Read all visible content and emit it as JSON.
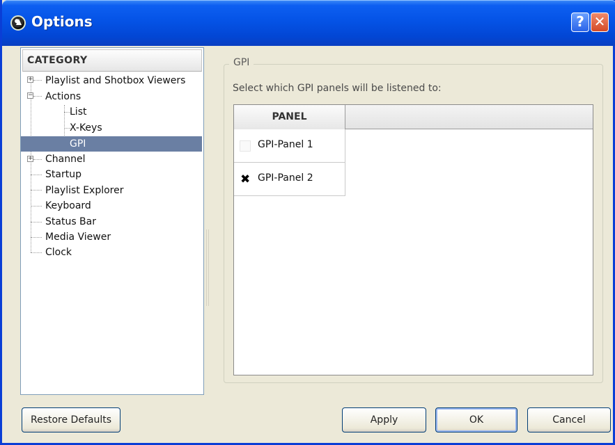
{
  "window": {
    "title": "Options",
    "help_glyph": "?",
    "close_glyph": "✕",
    "accent": "#0553e6"
  },
  "sidebar": {
    "header": "CATEGORY",
    "items": [
      {
        "label": "Playlist and Shotbox Viewers",
        "expander": "+"
      },
      {
        "label": "Actions",
        "expander": "−"
      },
      {
        "label": "List"
      },
      {
        "label": "X-Keys"
      },
      {
        "label": "GPI",
        "selected": true
      },
      {
        "label": "Channel",
        "expander": "+"
      },
      {
        "label": "Startup"
      },
      {
        "label": "Playlist Explorer"
      },
      {
        "label": "Keyboard"
      },
      {
        "label": "Status Bar"
      },
      {
        "label": "Media Viewer"
      },
      {
        "label": "Clock"
      }
    ],
    "selected_color": "#6a7fa3"
  },
  "main": {
    "group_title": "GPI",
    "instruction": "Select which GPI panels will be listened to:",
    "table": {
      "column": "PANEL",
      "rows": [
        {
          "label": "GPI-Panel 1",
          "checked": false,
          "mark": ""
        },
        {
          "label": "GPI-Panel 2",
          "checked": true,
          "mark": "✖"
        }
      ]
    }
  },
  "buttons": {
    "restore": "Restore Defaults",
    "apply": "Apply",
    "ok": "OK",
    "cancel": "Cancel"
  }
}
